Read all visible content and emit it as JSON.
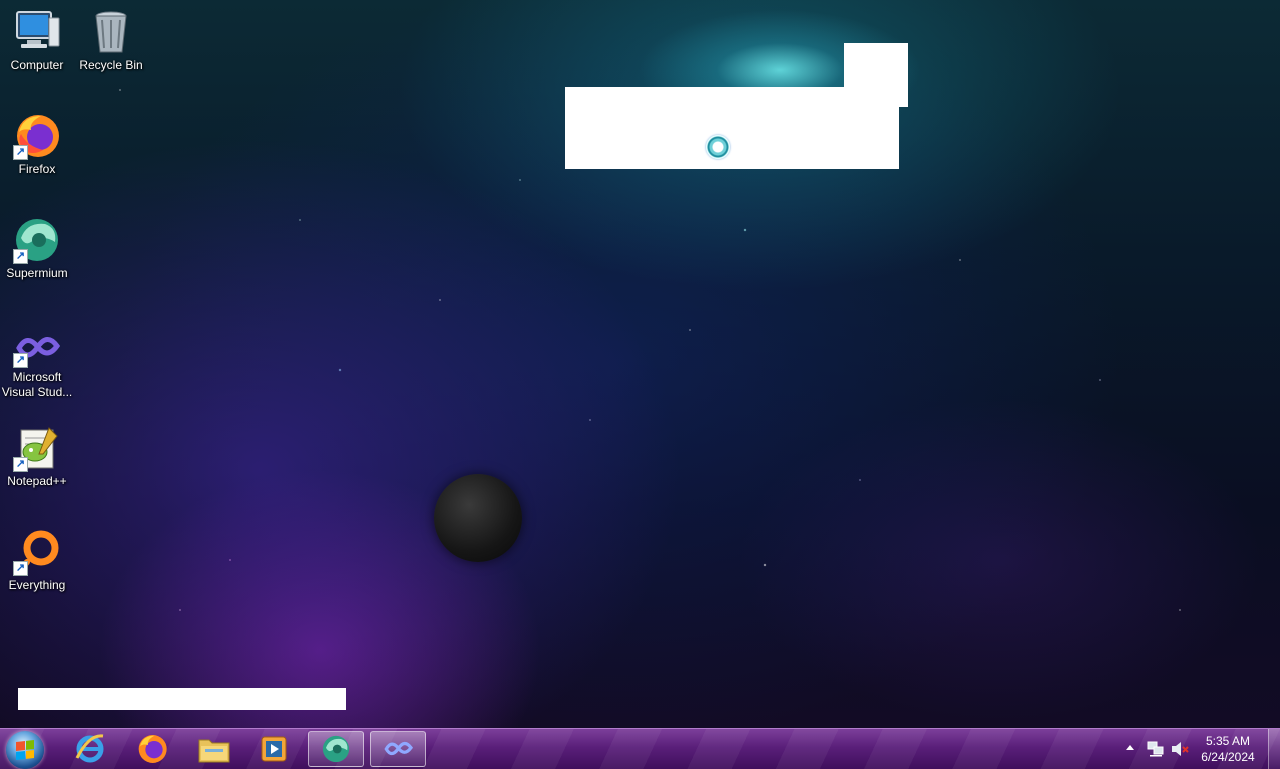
{
  "desktop": {
    "icons": [
      {
        "label": "Computer",
        "icon": "computer-icon"
      },
      {
        "label": "Recycle Bin",
        "icon": "recycle-bin-icon"
      },
      {
        "label": "Firefox",
        "icon": "firefox-icon",
        "shortcut": true
      },
      {
        "label": "Supermium",
        "icon": "supermium-icon",
        "shortcut": true
      },
      {
        "label": "Microsoft Visual Stud...",
        "label_line1": "Microsoft",
        "label_line2": "Visual Stud...",
        "icon": "visual-studio-icon",
        "shortcut": true
      },
      {
        "label": "Notepad++",
        "icon": "notepadplusplus-icon",
        "shortcut": true
      },
      {
        "label": "Everything",
        "icon": "everything-icon",
        "shortcut": true
      }
    ]
  },
  "taskbar": {
    "start_icon": "windows-logo-icon",
    "pinned": [
      {
        "name": "internet-explorer",
        "icon": "internet-explorer-icon"
      },
      {
        "name": "firefox",
        "icon": "firefox-icon"
      },
      {
        "name": "file-explorer",
        "icon": "folder-icon"
      },
      {
        "name": "media-player",
        "icon": "media-player-icon"
      },
      {
        "name": "supermium",
        "icon": "supermium-icon",
        "active": true
      },
      {
        "name": "visual-studio",
        "icon": "visual-studio-icon",
        "active": true
      }
    ],
    "tray": {
      "icons": [
        "show-hidden-icons-arrow",
        "network-icon",
        "volume-muted-icon"
      ],
      "time": "5:35 AM",
      "date": "6/24/2024"
    }
  },
  "colors": {
    "taskbar": "#5a1f7a",
    "accent_cyan": "#6fd0d8"
  }
}
